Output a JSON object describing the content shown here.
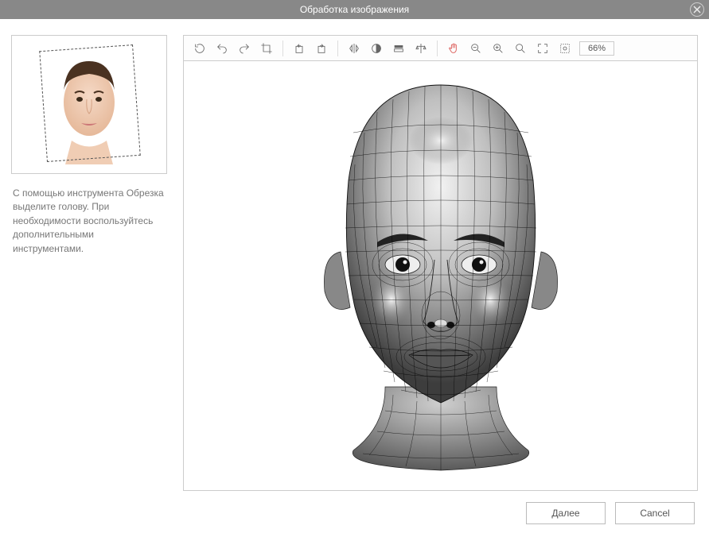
{
  "window": {
    "title": "Обработка изображения"
  },
  "sidebar": {
    "hint": "С помощью инструмента Обрезка выделите голову. При необходимости воспользуйтесь дополнительными инструментами."
  },
  "toolbar": {
    "zoom_level": "66%"
  },
  "buttons": {
    "next": "Далее",
    "cancel": "Cancel"
  }
}
